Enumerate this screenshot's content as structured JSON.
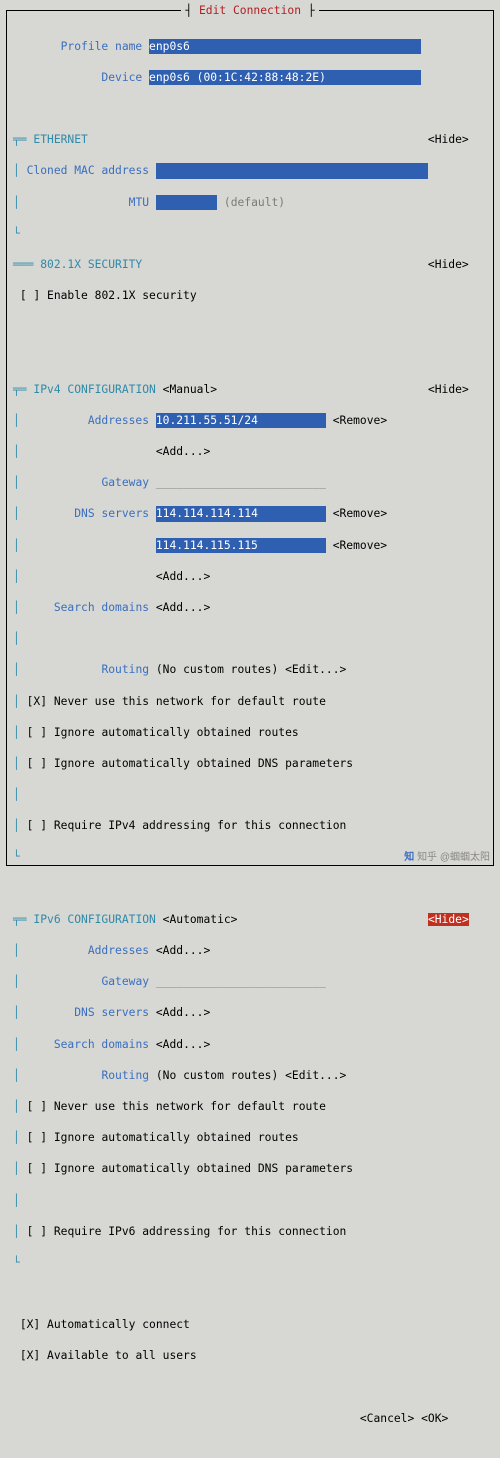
{
  "title": "Edit Connection",
  "labels": {
    "profile_name": "Profile name",
    "device": "Device",
    "ethernet": "ETHERNET",
    "cloned_mac": "Cloned MAC address",
    "mtu": "MTU",
    "sec8021x": "802.1X SECURITY",
    "enable_8021x": "Enable 802.1X security",
    "ipv4": "IPv4 CONFIGURATION",
    "ipv6": "IPv6 CONFIGURATION",
    "addresses": "Addresses",
    "gateway": "Gateway",
    "dns": "DNS servers",
    "search_domains": "Search domains",
    "routing": "Routing",
    "no_routes": "(No custom routes)",
    "edit": "<Edit...>",
    "add": "<Add...>",
    "remove": "<Remove>",
    "hide": "<Hide>",
    "manual": "<Manual>",
    "automatic": "<Automatic>",
    "never_default": "Never use this network for default route",
    "ignore_routes": "Ignore automatically obtained routes",
    "ignore_dns": "Ignore automatically obtained DNS parameters",
    "require_ipv4": "Require IPv4 addressing for this connection",
    "require_ipv6": "Require IPv6 addressing for this connection",
    "auto_connect": "Automatically connect",
    "avail_all": "Available to all users",
    "cancel": "<Cancel>",
    "ok": "<OK>",
    "mtu_default": "(default)"
  },
  "values": {
    "profile_name": "enp0s6",
    "device": "enp0s6 (00:1C:42:88:48:2E)",
    "mtu": "",
    "ipv4_addr": "10.211.55.51/24",
    "dns1": "114.114.114.114",
    "dns2": "114.114.115.115"
  },
  "checks": {
    "x8021x": "[ ]",
    "v4_never": "[X]",
    "v4_ign_routes": "[ ]",
    "v4_ign_dns": "[ ]",
    "v4_require": "[ ]",
    "v6_never": "[ ]",
    "v6_ign_routes": "[ ]",
    "v6_ign_dns": "[ ]",
    "v6_require": "[ ]",
    "auto_connect": "[X]",
    "avail_all": "[X]"
  },
  "watermark": "知乎 @蝈蝈太阳"
}
